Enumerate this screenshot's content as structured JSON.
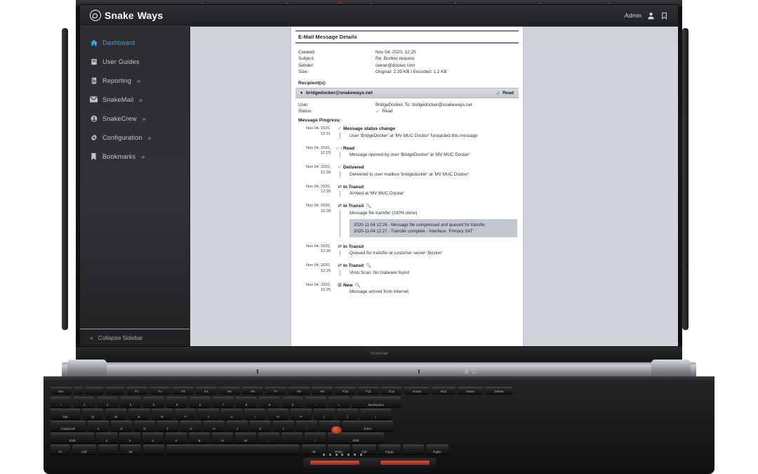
{
  "header": {
    "brand_prefix": "Snake",
    "brand_suffix": "Ways",
    "logo_icon": "snake-circle-logo",
    "admin_label": "Admin",
    "user_icon": "user-icon",
    "bookmark_icon": "bookmark-icon"
  },
  "sidebar": {
    "items": [
      {
        "label": "Dashboard",
        "icon": "home-icon",
        "chevron": "",
        "active": true
      },
      {
        "label": "User Guides",
        "icon": "book-icon",
        "chevron": "",
        "active": false
      },
      {
        "label": "Reporting",
        "icon": "chart-icon",
        "chevron": "»",
        "active": false
      },
      {
        "label": "SnakeMail",
        "icon": "envelope-icon",
        "chevron": "»",
        "active": false
      },
      {
        "label": "SnakeCrew",
        "icon": "people-icon",
        "chevron": "»",
        "active": false
      },
      {
        "label": "Configuration",
        "icon": "gear-icon",
        "chevron": "»",
        "active": false
      },
      {
        "label": "Bookmarks",
        "icon": "bookmark-icon",
        "chevron": "»",
        "active": false
      }
    ],
    "collapse_label": "Collapse Sidebar",
    "collapse_icon": "double-chevron-left-icon"
  },
  "card": {
    "title": "E-Mail Message Details",
    "meta": [
      {
        "key": "Created:",
        "value": "Nov 04, 2020, 12:25"
      },
      {
        "key": "Subject:",
        "value": "Re: Bunker request"
      },
      {
        "key": "Sender:",
        "value": "owner@docker.com"
      },
      {
        "key": "Size:",
        "value": "Original: 2.39 KB / Encoded: 1.2 KB"
      }
    ],
    "recipients_label": "Recipient(s):",
    "recipient": {
      "expand_icon": "chevron-down-icon",
      "email": "bridgedocker@snakeways.net",
      "status_icon": "read-check-icon",
      "status": "Read"
    },
    "detail_rows": [
      {
        "key": "User:",
        "value": "BridgeDocker, To: bridgedocker@snakeways.net",
        "icon": ""
      },
      {
        "key": "Status:",
        "value": "Read",
        "icon": "read-check-icon"
      }
    ],
    "progress_label": "Message Progress:",
    "events": [
      {
        "date": "Nov 04, 2020,",
        "time": "12:31",
        "icon": "check-icon",
        "icon_kind": "check",
        "title": "Message status change",
        "magnifier": false,
        "description": "User 'BridgeDocker' at 'MV MUC Docker' forwarded this message",
        "details": []
      },
      {
        "date": "Nov 04, 2020,",
        "time": "12:29",
        "icon": "double-check-icon",
        "icon_kind": "dcheck",
        "title": "Read",
        "magnifier": false,
        "description": "Message opened by user 'BridgeDocker' at 'MV MUC Docker'",
        "details": []
      },
      {
        "date": "Nov 04, 2020,",
        "time": "12:28",
        "icon": "check-icon",
        "icon_kind": "check",
        "title": "Delivered",
        "magnifier": false,
        "description": "Delivered to user mailbox 'bridgedocker' at 'MV MUC Docker'",
        "details": []
      },
      {
        "date": "Nov 04, 2020,",
        "time": "12:28",
        "icon": "transfer-arrows-icon",
        "icon_kind": "arrows",
        "title": "In Transit",
        "magnifier": false,
        "description": "Arrived at 'MV MUC Docker'",
        "details": []
      },
      {
        "date": "Nov 04, 2020,",
        "time": "12:28",
        "icon": "transfer-arrows-icon",
        "icon_kind": "arrows",
        "title": "In Transit",
        "magnifier": true,
        "description": "Message file transfer (100% done)",
        "details": [
          "2020-11-04 12:26 - Message file compressed and queued for transfer",
          "2020-11-04 12:27 - Transfer complete - Interface: 'Primary SAT'"
        ]
      },
      {
        "date": "Nov 04, 2020,",
        "time": "12:26",
        "icon": "transfer-arrows-icon",
        "icon_kind": "arrows",
        "title": "In Transit",
        "magnifier": false,
        "description": "Queued for transfer at customer server 'Docker'",
        "details": []
      },
      {
        "date": "Nov 04, 2020,",
        "time": "12:25",
        "icon": "transfer-arrows-icon",
        "icon_kind": "arrows",
        "title": "In Transit",
        "magnifier": true,
        "description": "Virus Scan: No malware found",
        "details": []
      },
      {
        "date": "Nov 04, 2020,",
        "time": "12:25",
        "icon": "new-box-icon",
        "icon_kind": "new",
        "title": "New",
        "magnifier": true,
        "description": "Message arrived from Internet",
        "details": []
      }
    ]
  },
  "device": {
    "brand_label": "ThinkPad"
  },
  "colors": {
    "accent": "#2da7e6",
    "status_green": "#3faa52",
    "sidebar_bg": "#303235",
    "topbar_bg": "#26272a",
    "content_bg": "#cfd3da",
    "card_bg": "#ffffff",
    "detail_box_bg": "#c3c7ce"
  }
}
